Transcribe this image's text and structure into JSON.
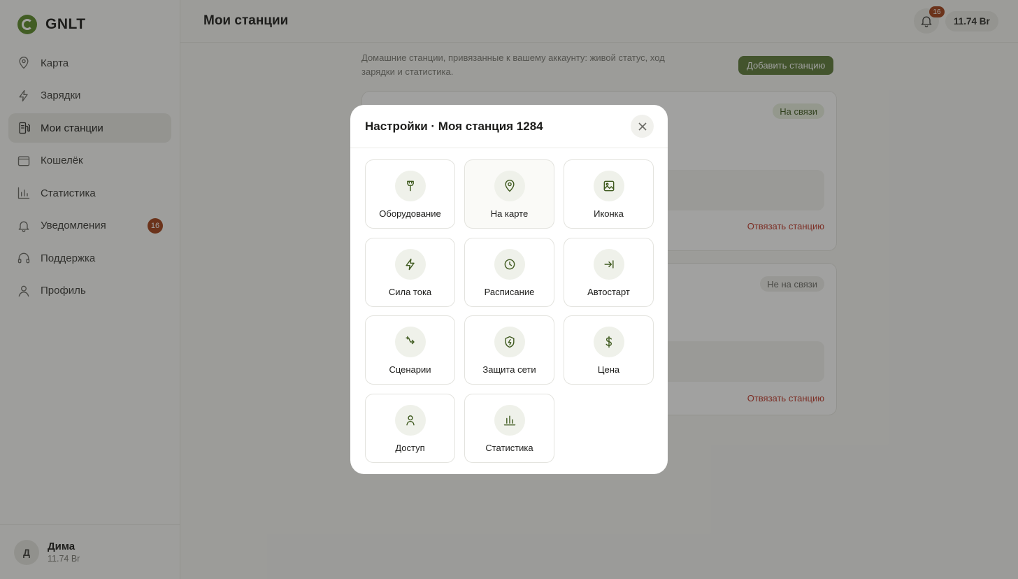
{
  "app": {
    "logo_text": "GNLT"
  },
  "sidebar": {
    "items": [
      {
        "label": "Карта",
        "icon": "map-pin-icon"
      },
      {
        "label": "Зарядки",
        "icon": "lightning-icon"
      },
      {
        "label": "Мои станции",
        "icon": "station-icon",
        "active": true
      },
      {
        "label": "Кошелёк",
        "icon": "wallet-icon"
      },
      {
        "label": "Статистика",
        "icon": "chart-icon"
      },
      {
        "label": "Уведомления",
        "icon": "bell-icon",
        "badge": "16"
      },
      {
        "label": "Поддержка",
        "icon": "headphones-icon"
      },
      {
        "label": "Профиль",
        "icon": "user-icon"
      }
    ]
  },
  "user": {
    "initial": "Д",
    "name": "Дима",
    "balance": "11.74 Br"
  },
  "header": {
    "title": "Мои станции",
    "notifications_count": "16",
    "balance": "11.74 Br"
  },
  "main": {
    "intro": "Домашние станции, привязанные к вашему аккаунту: живой статус, ход зарядки и статистика.",
    "add_button": "Добавить станцию",
    "stations": [
      {
        "status": "На связи",
        "unlink": "Отвязать станцию"
      },
      {
        "status": "Не на связи",
        "unlink": "Отвязать станцию"
      }
    ]
  },
  "modal": {
    "title": "Настройки · Моя станция 1284",
    "close_icon": "close-icon",
    "tiles": [
      {
        "label": "Оборудование",
        "icon": "plug-icon"
      },
      {
        "label": "На карте",
        "icon": "map-pin-icon"
      },
      {
        "label": "Иконка",
        "icon": "image-icon"
      },
      {
        "label": "Сила тока",
        "icon": "lightning-icon"
      },
      {
        "label": "Расписание",
        "icon": "clock-icon"
      },
      {
        "label": "Автостарт",
        "icon": "arrow-to-line-icon"
      },
      {
        "label": "Сценарии",
        "icon": "route-icon"
      },
      {
        "label": "Защита сети",
        "icon": "shield-bolt-icon"
      },
      {
        "label": "Цена",
        "icon": "dollar-icon"
      },
      {
        "label": "Доступ",
        "icon": "person-icon"
      },
      {
        "label": "Статистика",
        "icon": "bar-chart-icon"
      }
    ]
  }
}
